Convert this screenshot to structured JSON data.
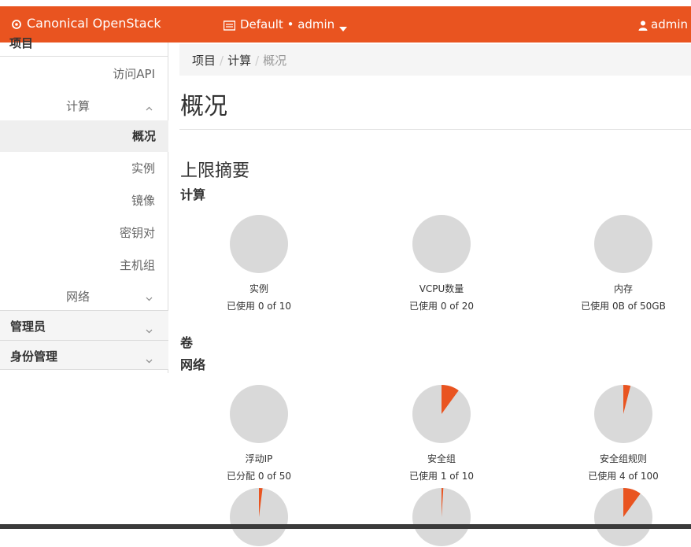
{
  "navbar": {
    "brand": "Canonical OpenStack",
    "project": "Default • admin",
    "user": "admin"
  },
  "sidebar": {
    "clipped_top": "项目",
    "api_access": "访问API",
    "compute_group": "计算",
    "overview": "概况",
    "instances": "实例",
    "images": "镜像",
    "key_pairs": "密钥对",
    "server_groups": "主机组",
    "network_group": "网络",
    "admin_panel": "管理员",
    "identity_panel": "身份管理"
  },
  "breadcrumb": {
    "items": [
      "项目",
      "计算",
      "概况"
    ]
  },
  "page": {
    "title": "概况",
    "limit_summary": "上限摘要",
    "section_compute": "计算",
    "section_volume": "卷",
    "section_network": "网络"
  },
  "colors": {
    "accent": "#e95420",
    "pie_bg": "#d9d9d9"
  },
  "limits": [
    {
      "label": "实例",
      "usage_prefix": "已使用",
      "usage_value": "0 of 10",
      "fraction": 0
    },
    {
      "label": "VCPU数量",
      "usage_prefix": "已使用",
      "usage_value": "0 of 20",
      "fraction": 0
    },
    {
      "label": "内存",
      "usage_prefix": "已使用",
      "usage_value": "0B of 50GB",
      "fraction": 0
    },
    {
      "label": "浮动IP",
      "usage_prefix": "已分配",
      "usage_value": "0 of 50",
      "fraction": 0
    },
    {
      "label": "安全组",
      "usage_prefix": "已使用",
      "usage_value": "1 of 10",
      "fraction": 0.1
    },
    {
      "label": "安全组规则",
      "usage_prefix": "已使用",
      "usage_value": "4 of 100",
      "fraction": 0.04
    },
    {
      "label": "",
      "usage_prefix": "",
      "usage_value": "",
      "fraction": 0.02
    },
    {
      "label": "",
      "usage_prefix": "",
      "usage_value": "",
      "fraction": 0.01
    },
    {
      "label": "",
      "usage_prefix": "",
      "usage_value": "",
      "fraction": 0.1
    }
  ]
}
